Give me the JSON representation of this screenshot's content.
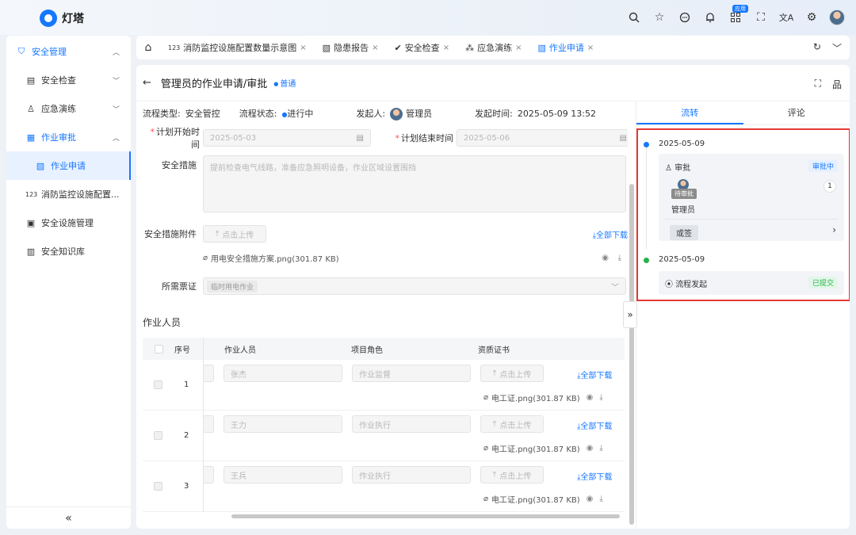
{
  "app": {
    "name": "灯塔"
  },
  "topbar": {
    "badge": "应用"
  },
  "sidebar": {
    "items": [
      {
        "label": "安全管理",
        "icon": "shield-icon",
        "expanded": true
      },
      {
        "label": "安全检查",
        "icon": "calendar-icon"
      },
      {
        "label": "应急演练",
        "icon": "people-icon"
      },
      {
        "label": "作业审批",
        "icon": "grid-icon",
        "expanded": true
      },
      {
        "label": "作业申请",
        "icon": "document-icon",
        "selected": true
      },
      {
        "label": "消防监控设施配置...",
        "icon": "number-icon"
      },
      {
        "label": "安全设施管理",
        "icon": "device-icon"
      },
      {
        "label": "安全知识库",
        "icon": "barcode-icon"
      }
    ],
    "collapse_glyph": "«"
  },
  "tabs": [
    {
      "label": "消防监控设施配置数量示意图",
      "icon": "123"
    },
    {
      "label": "隐患报告",
      "icon": "doc"
    },
    {
      "label": "安全检查",
      "icon": "check"
    },
    {
      "label": "应急演练",
      "icon": "tri"
    },
    {
      "label": "作业申请",
      "icon": "doc",
      "active": true
    }
  ],
  "page": {
    "title": "管理员的作业申请/审批",
    "tag": "普通",
    "info": {
      "flow_type_label": "流程类型:",
      "flow_type": "安全管控",
      "flow_status_label": "流程状态:",
      "flow_status": "进行中",
      "initiator_label": "发起人:",
      "initiator": "管理员",
      "start_time_label": "发起时间:",
      "start_time": "2025-05-09 13:52"
    }
  },
  "form": {
    "plan_start_label": "计划开始时间",
    "plan_start": "2025-05-03",
    "plan_end_label": "计划结束时间",
    "plan_end": "2025-05-06",
    "measures_label": "安全措施",
    "measures_placeholder": "提前检查电气线路，准备应急照明设备，作业区域设置围挡",
    "attach_label": "安全措施附件",
    "upload": "点击上传",
    "download_all": "全部下载",
    "attach_file": "用电安全措施方案.png(301.87 KB)",
    "ticket_label": "所需票证",
    "ticket_value": "临时用电作业"
  },
  "workers": {
    "title": "作业人员",
    "headers": {
      "index": "序号",
      "person": "作业人员",
      "role": "项目角色",
      "cert": "资质证书"
    },
    "rows": [
      {
        "index": "1",
        "person": "张杰",
        "role": "作业监督",
        "file": "电工证.png(301.87 KB)"
      },
      {
        "index": "2",
        "person": "王力",
        "role": "作业执行",
        "file": "电工证.png(301.87 KB)"
      },
      {
        "index": "3",
        "person": "王兵",
        "role": "作业执行",
        "file": "电工证.png(301.87 KB)"
      }
    ]
  },
  "right": {
    "tabs": [
      "流转",
      "评论"
    ],
    "timeline": [
      {
        "date": "2025-05-09",
        "node": "审批",
        "status": "审批中",
        "pending": "待审批",
        "user": "管理员",
        "count": "1",
        "sign": "或签"
      },
      {
        "date": "2025-05-09",
        "node": "流程发起",
        "status": "已提交"
      }
    ]
  },
  "colors": {
    "accent": "#1677ff",
    "success": "#27b148",
    "highlight": "#e53935"
  }
}
